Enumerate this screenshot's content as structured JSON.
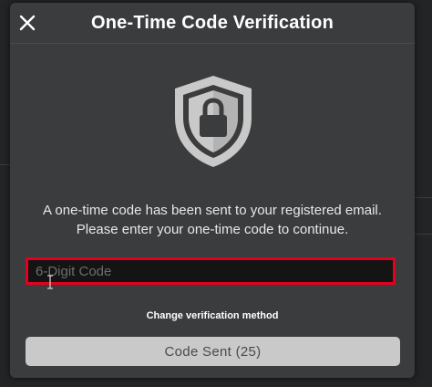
{
  "modal": {
    "title": "One-Time Code Verification",
    "message_line1": "A one-time code has been sent to your registered email.",
    "message_line2": "Please enter your one-time code to continue.",
    "code_input": {
      "placeholder": "6-Digit Code",
      "value": ""
    },
    "change_method_label": "Change verification method",
    "submit_button_label": "Code Sent (25)",
    "icons": {
      "close": "close-icon",
      "shield": "shield-lock-icon"
    }
  },
  "colors": {
    "modal_bg": "#3b3c3e",
    "input_highlight": "#e3001e",
    "button_disabled_bg": "#c9c9c9"
  }
}
